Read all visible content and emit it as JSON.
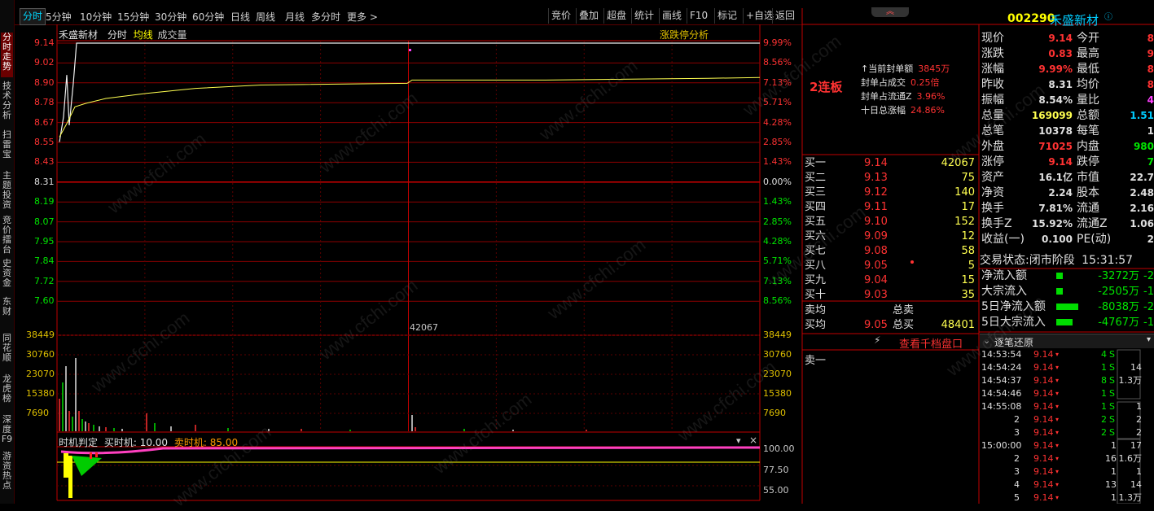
{
  "vertical_tabs": [
    "分时走势",
    "技术分析",
    "扫雷宝",
    "主题投资",
    "竞价擂台",
    "史资金",
    "东财",
    "同花顺",
    "龙虎榜",
    "深度F9",
    "游资热点"
  ],
  "toolbar": {
    "periods": [
      "分时",
      "5分钟",
      "10分钟",
      "15分钟",
      "30分钟",
      "60分钟",
      "日线",
      "周线",
      "月线",
      "多分时",
      "更多 >"
    ],
    "right_buttons": [
      "竞价",
      "叠加",
      "超盘",
      "统计",
      "画线",
      "F10",
      "标记",
      "+自选",
      "返回"
    ]
  },
  "chart_header": {
    "stock_name": "禾盛新材",
    "mode": "分时",
    "avg_label": "均线",
    "vol_label": "成交量",
    "analysis_link": "涨跌停分析"
  },
  "price_axis": {
    "left": [
      "9.14",
      "9.02",
      "8.90",
      "8.78",
      "8.67",
      "8.55",
      "8.43",
      "8.31",
      "8.19",
      "8.07",
      "7.95",
      "7.84",
      "7.72",
      "7.60"
    ],
    "right": [
      "9.99%",
      "8.56%",
      "7.13%",
      "5.71%",
      "4.28%",
      "2.85%",
      "1.43%",
      "0.00%",
      "1.43%",
      "2.85%",
      "4.28%",
      "5.71%",
      "7.13%",
      "8.56%"
    ]
  },
  "volume_axis": {
    "labels": [
      "38449",
      "30760",
      "23070",
      "15380",
      "7690"
    ],
    "peak_label": "42067"
  },
  "chart_data": {
    "type": "line",
    "series": [
      {
        "values": [
          8.55,
          8.7,
          8.95,
          8.65,
          9.14,
          9.14,
          9.14,
          9.14,
          9.14,
          9.14,
          9.14,
          9.14,
          9.14,
          9.14,
          9.14,
          9.14,
          9.14,
          9.14,
          9.14,
          9.14
        ]
      },
      {
        "values": [
          8.6,
          8.66,
          8.72,
          8.76,
          8.78,
          8.81,
          8.84,
          8.86,
          8.87,
          8.88,
          8.89,
          8.89,
          8.89,
          8.9,
          8.9,
          8.9,
          8.91,
          8.92,
          8.92,
          8.93
        ]
      }
    ],
    "ylim": [
      7.48,
      9.14
    ]
  },
  "indicator": {
    "name": "时机判定",
    "buy_label": "买时机: 10.00",
    "sell_label": "卖时机: 85.00",
    "levels": [
      "100.00",
      "77.50",
      "55.00"
    ]
  },
  "limit_info": {
    "badge": "2连板",
    "rows": [
      {
        "label": "当前封单额",
        "value": "3845万"
      },
      {
        "label": "封单占成交",
        "value": "0.25倍"
      },
      {
        "label": "封单占流通Z",
        "value": "3.96%"
      },
      {
        "label": "十日总涨幅",
        "value": "24.86%"
      }
    ]
  },
  "order_book": {
    "bids": [
      {
        "label": "买一",
        "price": "9.14",
        "vol": "42067"
      },
      {
        "label": "买二",
        "price": "9.13",
        "vol": "75"
      },
      {
        "label": "买三",
        "price": "9.12",
        "vol": "140"
      },
      {
        "label": "买四",
        "price": "9.11",
        "vol": "17"
      },
      {
        "label": "买五",
        "price": "9.10",
        "vol": "152"
      },
      {
        "label": "买六",
        "price": "9.09",
        "vol": "12"
      },
      {
        "label": "买七",
        "price": "9.08",
        "vol": "58"
      },
      {
        "label": "买八",
        "price": "9.05",
        "vol": "5"
      },
      {
        "label": "买九",
        "price": "9.04",
        "vol": "15"
      },
      {
        "label": "买十",
        "price": "9.03",
        "vol": "35"
      }
    ],
    "sell_avg_label": "卖均",
    "sell_total_label": "总卖",
    "buy_avg_label": "买均",
    "buy_avg": "9.05",
    "buy_total_label": "总买",
    "buy_total": "48401",
    "thousand_link": "查看千档盘口",
    "ask1_label": "卖一"
  },
  "quote": {
    "code": "002290",
    "name": "禾盛新材",
    "rows": [
      {
        "l1": "现价",
        "v1": "9.14",
        "l2": "今开",
        "v2": "8"
      },
      {
        "l1": "涨跌",
        "v1": "0.83",
        "l2": "最高",
        "v2": "9"
      },
      {
        "l1": "涨幅",
        "v1": "9.99%",
        "l2": "最低",
        "v2": "8"
      },
      {
        "l1": "昨收",
        "v1": "8.31",
        "l2": "均价",
        "v2": "8"
      },
      {
        "l1": "振幅",
        "v1": "8.54%",
        "l2": "量比",
        "v2": "4"
      },
      {
        "l1": "总量",
        "v1": "169099",
        "l2": "总额",
        "v2": "1.51"
      },
      {
        "l1": "总笔",
        "v1": "10378",
        "l2": "每笔",
        "v2": "1"
      },
      {
        "l1": "外盘",
        "v1": "71025",
        "l2": "内盘",
        "v2": "980"
      },
      {
        "l1": "涨停",
        "v1": "9.14",
        "l2": "跌停",
        "v2": "7"
      },
      {
        "l1": "资产",
        "v1": "16.1亿",
        "l2": "市值",
        "v2": "22.7"
      },
      {
        "l1": "净资",
        "v1": "2.24",
        "l2": "股本",
        "v2": "2.48"
      },
      {
        "l1": "换手",
        "v1": "7.81%",
        "l2": "流通",
        "v2": "2.16"
      },
      {
        "l1": "换手Z",
        "v1": "15.92%",
        "l2": "流通Z",
        "v2": "1.06"
      },
      {
        "l1": "收益(一)",
        "v1": "0.100",
        "l2": "PE(动)",
        "v2": "2"
      }
    ],
    "status_label": "交易状态:",
    "status_value": "闭市阶段",
    "status_time": "15:31:57"
  },
  "flows": [
    {
      "label": "净流入额",
      "value": "-3272万",
      "extra": "-2",
      "bar": 0.15
    },
    {
      "label": "大宗流入",
      "value": "-2505万",
      "extra": "-1",
      "bar": 0.1
    },
    {
      "label": "5日净流入额",
      "value": "-8038万",
      "extra": "-2",
      "bar": 0.9
    },
    {
      "label": "5日大宗流入",
      "value": "-4767万",
      "extra": "-1",
      "bar": 0.65
    }
  ],
  "tick_panel": {
    "title": "逐笔还原",
    "rows": [
      {
        "t": "14:53:54",
        "p": "9.14",
        "v": "4",
        "s": "S",
        "a": "",
        "b": ""
      },
      {
        "t": "14:54:24",
        "p": "9.14",
        "v": "1",
        "s": "S",
        "a": "14",
        "b": ""
      },
      {
        "t": "14:54:37",
        "p": "9.14",
        "v": "8",
        "s": "S",
        "a": "1.3万",
        "b": ""
      },
      {
        "t": "14:54:46",
        "p": "9.14",
        "v": "1",
        "s": "S",
        "a": "",
        "b": ""
      },
      {
        "t": "14:55:08",
        "p": "9.14",
        "v": "1",
        "s": "S",
        "a": "1",
        "b": ""
      },
      {
        "t": "2",
        "p": "9.14",
        "v": "2",
        "s": "S",
        "a": "2",
        "b": ""
      },
      {
        "t": "3",
        "p": "9.14",
        "v": "2",
        "s": "S",
        "a": "2",
        "b": ""
      },
      {
        "t": "15:00:00",
        "p": "9.14",
        "v": "1",
        "s": "",
        "a": "17",
        "b": ""
      },
      {
        "t": "2",
        "p": "9.14",
        "v": "16",
        "s": "",
        "a": "1.6万",
        "b": ""
      },
      {
        "t": "3",
        "p": "9.14",
        "v": "1",
        "s": "",
        "a": "1",
        "b": ""
      },
      {
        "t": "4",
        "p": "9.14",
        "v": "13",
        "s": "",
        "a": "14",
        "b": ""
      },
      {
        "t": "5",
        "p": "9.14",
        "v": "1",
        "s": "",
        "a": "1.3万",
        "b": ""
      }
    ]
  }
}
